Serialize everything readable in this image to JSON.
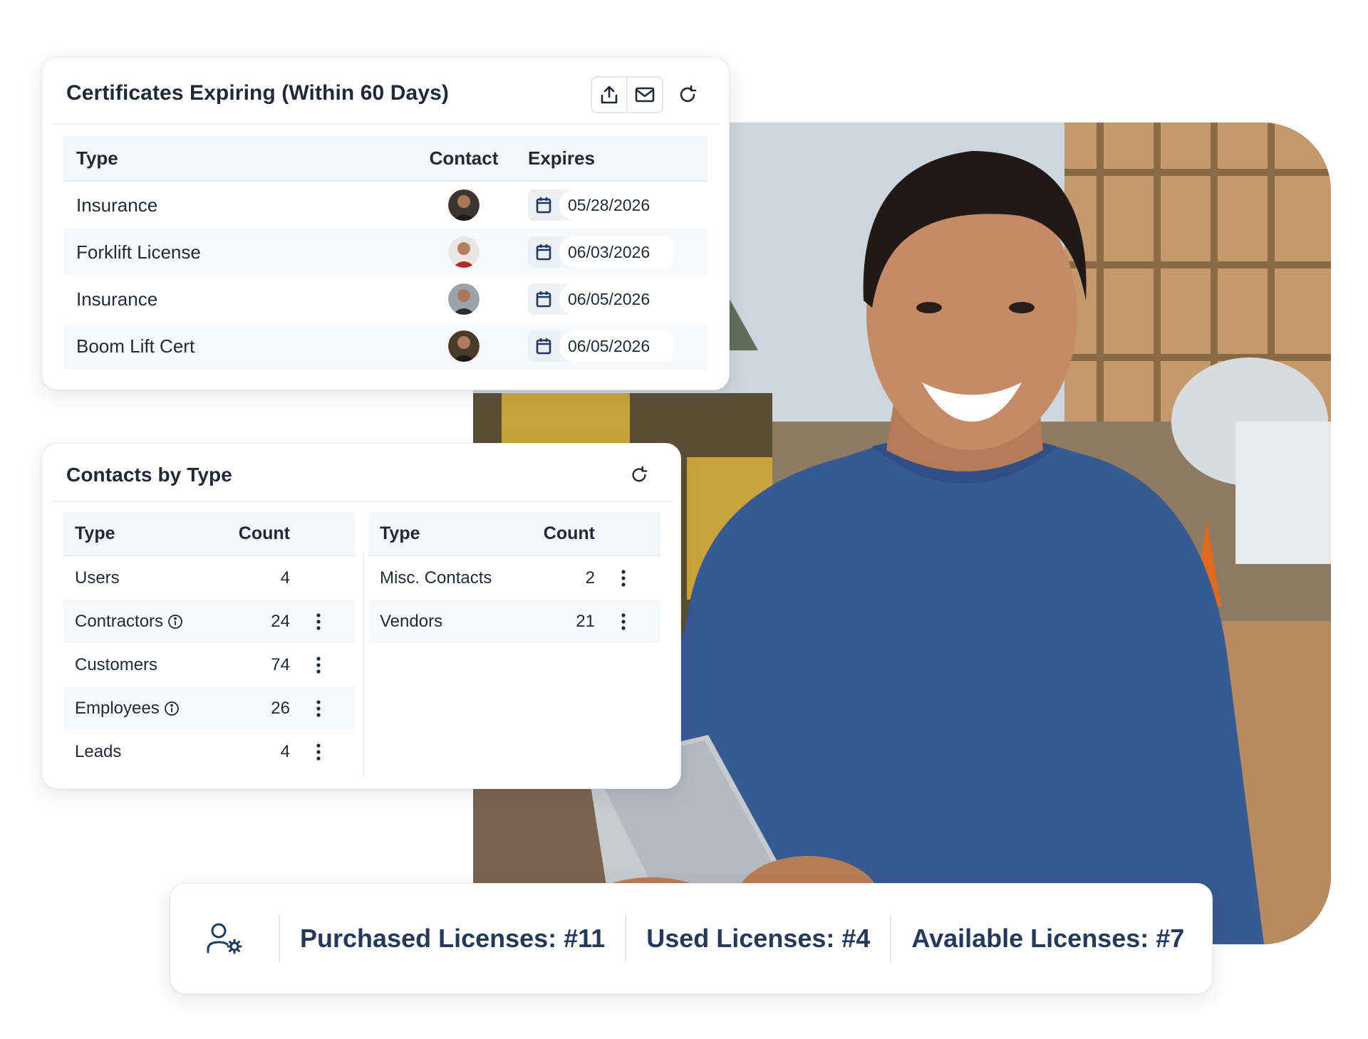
{
  "certificates": {
    "title": "Certificates Expiring (Within 60 Days)",
    "columns": {
      "type": "Type",
      "contact": "Contact",
      "expires": "Expires"
    },
    "rows": [
      {
        "type": "Insurance",
        "expires": "05/28/2026"
      },
      {
        "type": "Forklift License",
        "expires": "06/03/2026"
      },
      {
        "type": "Insurance",
        "expires": "06/05/2026"
      },
      {
        "type": "Boom Lift Cert",
        "expires": "06/05/2026"
      }
    ],
    "actions": [
      "export-icon",
      "email-icon",
      "refresh-icon"
    ]
  },
  "contacts": {
    "title": "Contacts by Type",
    "left": {
      "columns": {
        "type": "Type",
        "count": "Count"
      },
      "rows": [
        {
          "type": "Users",
          "count": "4"
        },
        {
          "type": "Contractors",
          "count": "24"
        },
        {
          "type": "Customers",
          "count": "74"
        },
        {
          "type": "Employees",
          "count": "26"
        },
        {
          "type": "Leads",
          "count": "4"
        }
      ]
    },
    "right": {
      "columns": {
        "type": "Type",
        "count": "Count"
      },
      "rows": [
        {
          "type": "Misc. Contacts",
          "count": "2"
        },
        {
          "type": "Vendors",
          "count": "21"
        }
      ]
    }
  },
  "licenses": {
    "icon": "user-gear-icon",
    "purchased": "Purchased Licenses: #11",
    "used": "Used Licenses: #4",
    "available": "Available Licenses: #7"
  },
  "colors": {
    "accent_navy": "#1f3a5f",
    "license_text": "#27395a",
    "table_header_bg": "#f5f6f8"
  }
}
